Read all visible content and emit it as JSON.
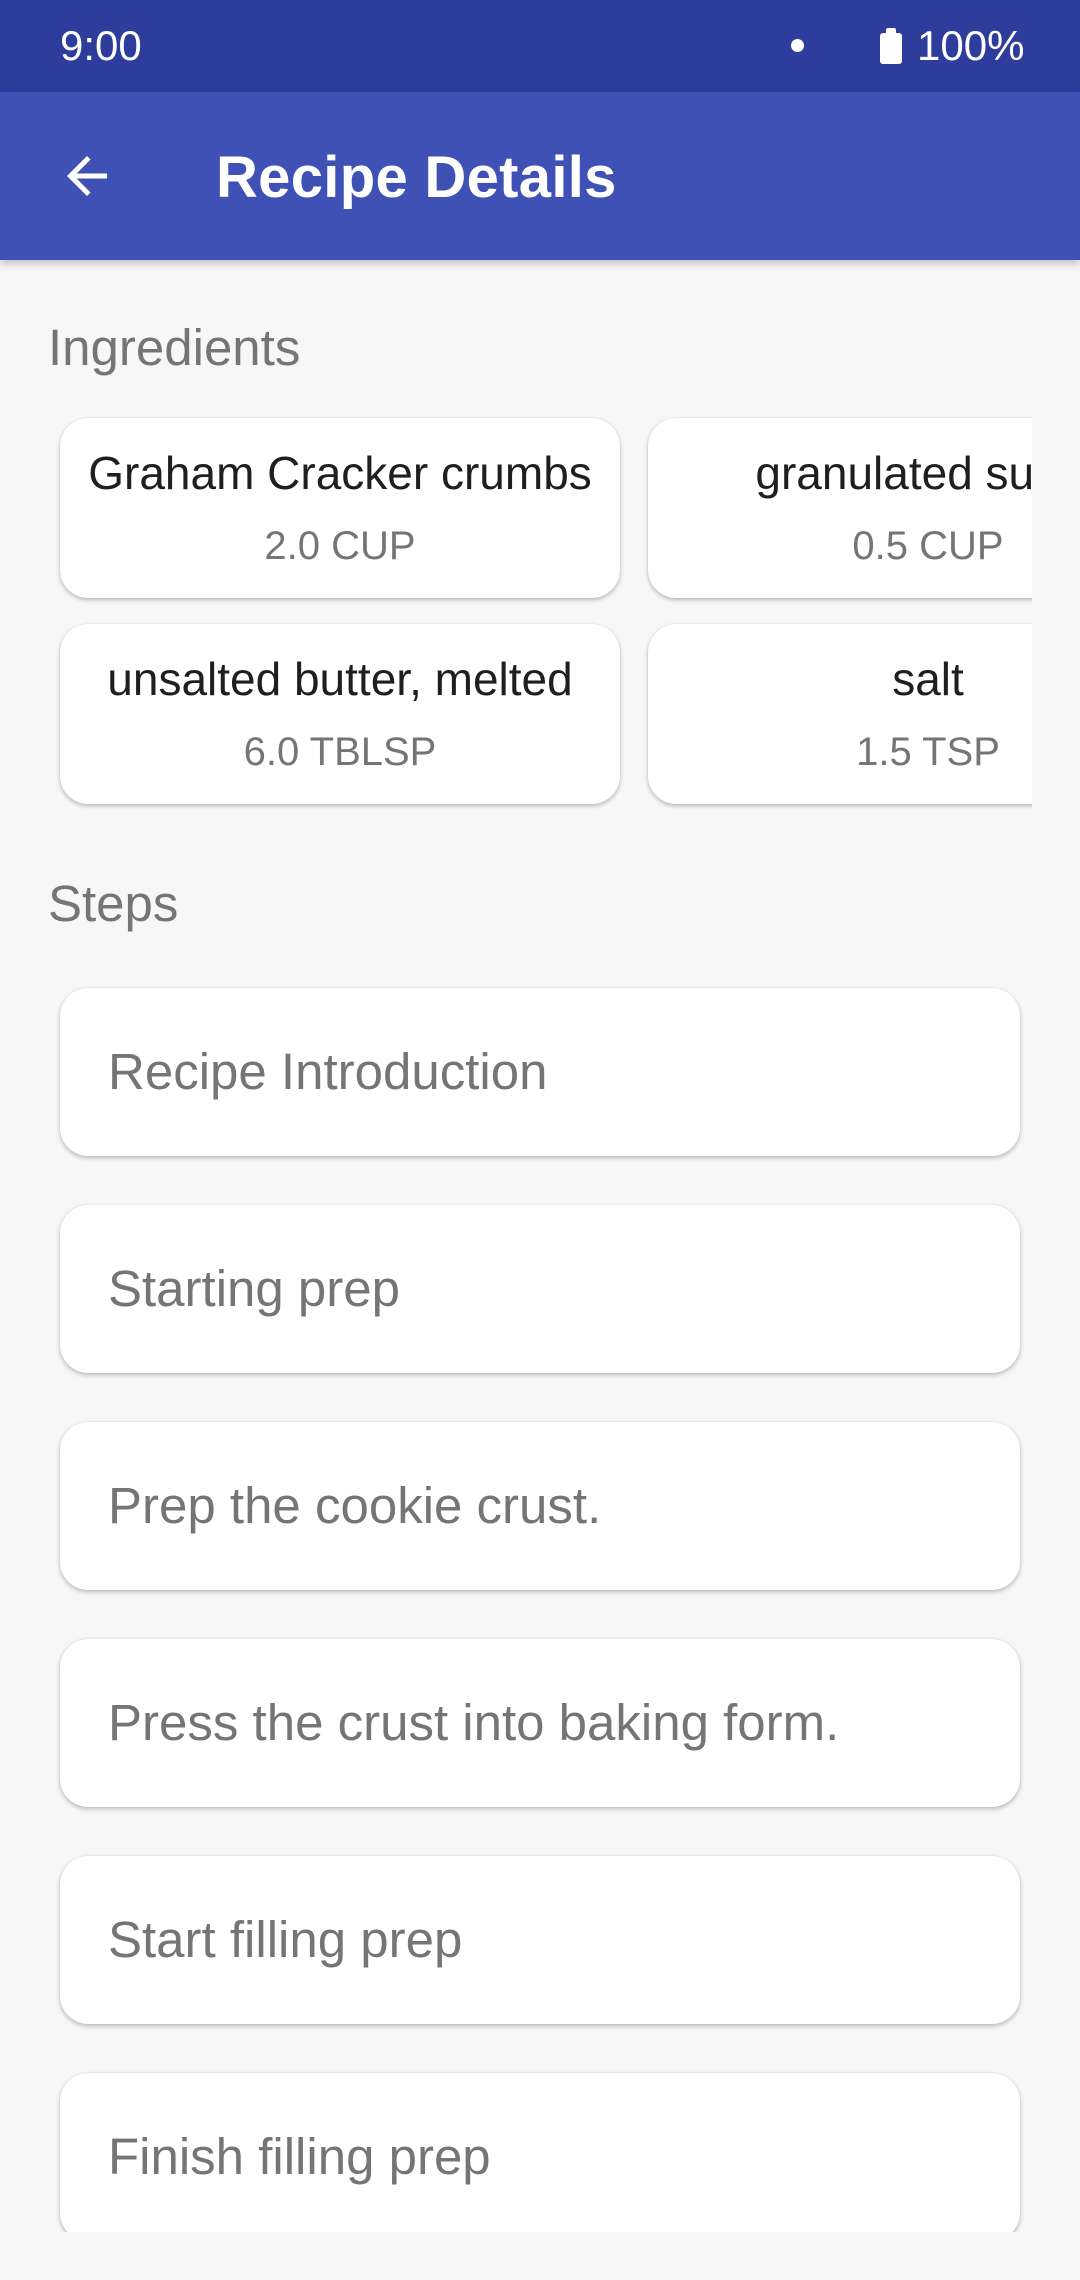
{
  "status_bar": {
    "time": "9:00",
    "battery": "100%"
  },
  "app_bar": {
    "title": "Recipe Details",
    "back_icon": "arrow-left-icon"
  },
  "sections": {
    "ingredients_title": "Ingredients",
    "steps_title": "Steps"
  },
  "ingredients": [
    {
      "name": "Graham Cracker crumbs",
      "quantity": "2.0 CUP"
    },
    {
      "name": "granulated sugar",
      "quantity": "0.5 CUP"
    },
    {
      "name": "unsalted butter, melted",
      "quantity": "6.0 TBLSP"
    },
    {
      "name": "salt",
      "quantity": "1.5 TSP"
    }
  ],
  "steps": [
    "Recipe Introduction",
    "Starting prep",
    "Prep the cookie crust.",
    "Press the crust into baking form.",
    "Start filling prep",
    "Finish filling prep"
  ],
  "colors": {
    "status_bar": "#2e3d9c",
    "app_bar": "#3f51b5",
    "background": "#f7f7f7"
  }
}
